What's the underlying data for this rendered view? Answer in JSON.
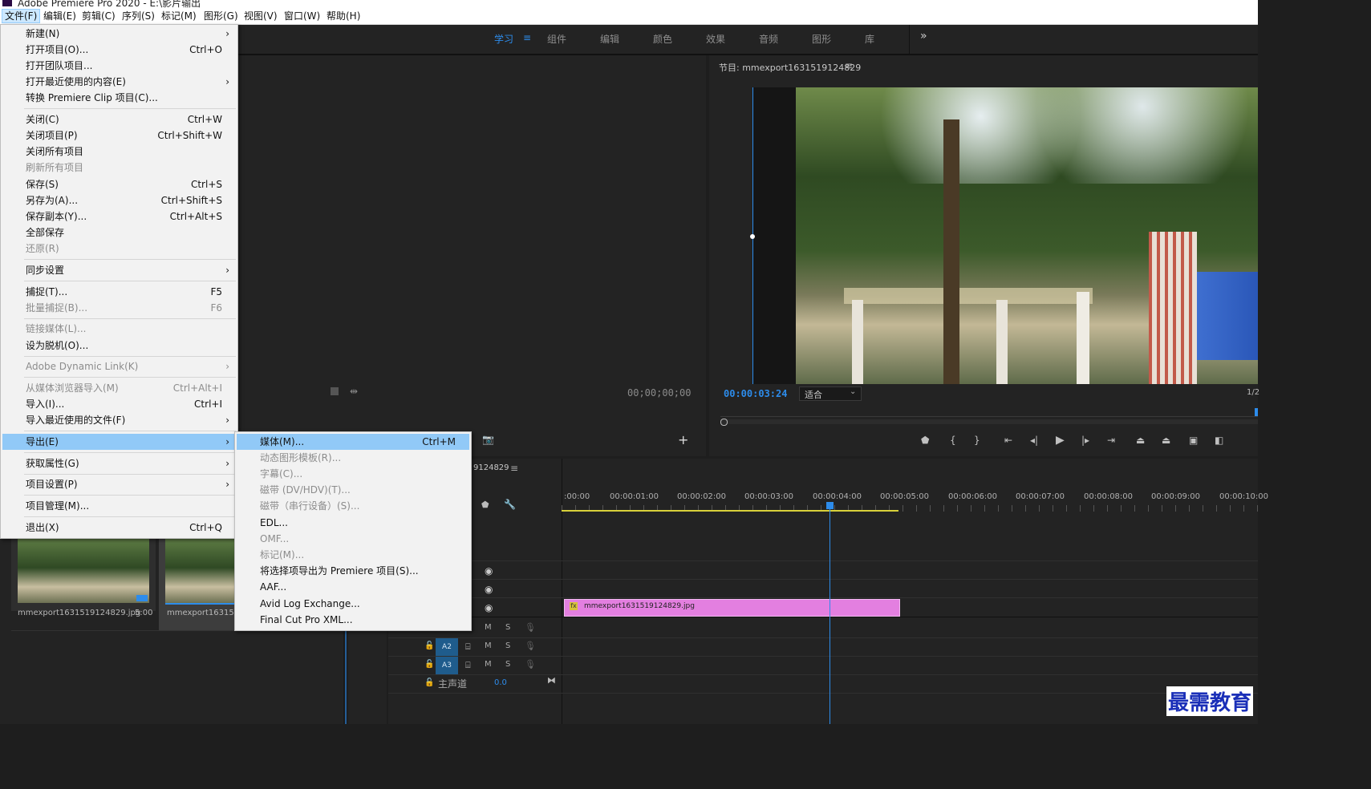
{
  "window": {
    "title": "Adobe Premiere Pro 2020 - E:\\影片输出"
  },
  "menubar": [
    {
      "label": "文件(F)",
      "active": true
    },
    {
      "label": "编辑(E)"
    },
    {
      "label": "剪辑(C)"
    },
    {
      "label": "序列(S)"
    },
    {
      "label": "标记(M)"
    },
    {
      "label": "图形(G)"
    },
    {
      "label": "视图(V)"
    },
    {
      "label": "窗口(W)"
    },
    {
      "label": "帮助(H)"
    }
  ],
  "workspaces": [
    {
      "label": "学习",
      "active": true
    },
    {
      "label": "组件"
    },
    {
      "label": "编辑"
    },
    {
      "label": "颜色"
    },
    {
      "label": "效果"
    },
    {
      "label": "音频"
    },
    {
      "label": "图形"
    },
    {
      "label": "库"
    }
  ],
  "file_menu": [
    {
      "label": "新建(N)",
      "submenu": true
    },
    {
      "label": "打开项目(O)...",
      "shortcut": "Ctrl+O"
    },
    {
      "label": "打开团队项目..."
    },
    {
      "label": "打开最近使用的内容(E)",
      "submenu": true
    },
    {
      "label": "转换 Premiere Clip 项目(C)..."
    },
    {
      "label": "关闭(C)",
      "shortcut": "Ctrl+W"
    },
    {
      "label": "关闭项目(P)",
      "shortcut": "Ctrl+Shift+W"
    },
    {
      "label": "关闭所有项目"
    },
    {
      "label": "刷新所有项目",
      "disabled": true
    },
    {
      "label": "保存(S)",
      "shortcut": "Ctrl+S"
    },
    {
      "label": "另存为(A)...",
      "shortcut": "Ctrl+Shift+S"
    },
    {
      "label": "保存副本(Y)...",
      "shortcut": "Ctrl+Alt+S"
    },
    {
      "label": "全部保存"
    },
    {
      "label": "还原(R)",
      "disabled": true
    },
    {
      "label": "同步设置",
      "submenu": true
    },
    {
      "label": "捕捉(T)...",
      "shortcut": "F5"
    },
    {
      "label": "批量捕捉(B)...",
      "shortcut": "F6",
      "disabled": true
    },
    {
      "label": "链接媒体(L)...",
      "disabled": true
    },
    {
      "label": "设为脱机(O)..."
    },
    {
      "label": "Adobe Dynamic Link(K)",
      "submenu": true,
      "disabled": true
    },
    {
      "label": "从媒体浏览器导入(M)",
      "shortcut": "Ctrl+Alt+I",
      "disabled": true
    },
    {
      "label": "导入(I)...",
      "shortcut": "Ctrl+I"
    },
    {
      "label": "导入最近使用的文件(F)",
      "submenu": true
    },
    {
      "label": "导出(E)",
      "submenu": true,
      "highlighted": true
    },
    {
      "label": "获取属性(G)",
      "submenu": true
    },
    {
      "label": "项目设置(P)",
      "submenu": true
    },
    {
      "label": "项目管理(M)..."
    },
    {
      "label": "退出(X)",
      "shortcut": "Ctrl+Q"
    }
  ],
  "export_submenu": [
    {
      "label": "媒体(M)...",
      "shortcut": "Ctrl+M",
      "highlighted": true
    },
    {
      "label": "动态图形模板(R)...",
      "disabled": true
    },
    {
      "label": "字幕(C)...",
      "disabled": true
    },
    {
      "label": "磁带 (DV/HDV)(T)...",
      "disabled": true
    },
    {
      "label": "磁带（串行设备）(S)...",
      "disabled": true
    },
    {
      "label": "EDL..."
    },
    {
      "label": "OMF...",
      "disabled": true
    },
    {
      "label": "标记(M)...",
      "disabled": true
    },
    {
      "label": "将选择项导出为 Premiere 项目(S)..."
    },
    {
      "label": "AAF..."
    },
    {
      "label": "Avid Log Exchange..."
    },
    {
      "label": "Final Cut Pro XML..."
    }
  ],
  "source_monitor": {
    "timecode": "00;00;00;00"
  },
  "program_monitor": {
    "title": "节目: mmexport1631519124829",
    "timecode": "00:00:03:24",
    "fit_label": "适合",
    "fraction": "1/2"
  },
  "project_panel": {
    "clips": [
      {
        "name": "mmexport1631519124829.jpg",
        "duration": "5:00"
      },
      {
        "name": "mmexport1631519"
      }
    ]
  },
  "timeline": {
    "sequence_tab": "9124829",
    "ruler": [
      ":00:00",
      "00:00:01:00",
      "00:00:02:00",
      "00:00:03:00",
      "00:00:04:00",
      "00:00:05:00",
      "00:00:06:00",
      "00:00:07:00",
      "00:00:08:00",
      "00:00:09:00",
      "00:00:10:00"
    ],
    "clip": {
      "name": "mmexport1631519124829.jpg",
      "fx": "fx"
    },
    "audio_tracks": [
      {
        "label": "A2",
        "m": "M",
        "s": "S"
      },
      {
        "label": "A3",
        "m": "M",
        "s": "S"
      }
    ],
    "track_m": "M",
    "track_s": "S",
    "master": {
      "label": "主声道",
      "value": "0.0"
    }
  },
  "watermark": "最需教育",
  "colors": {
    "accent": "#2d8ceb",
    "clip": "#e37fe0",
    "menu_highlight": "#91c9f7"
  }
}
